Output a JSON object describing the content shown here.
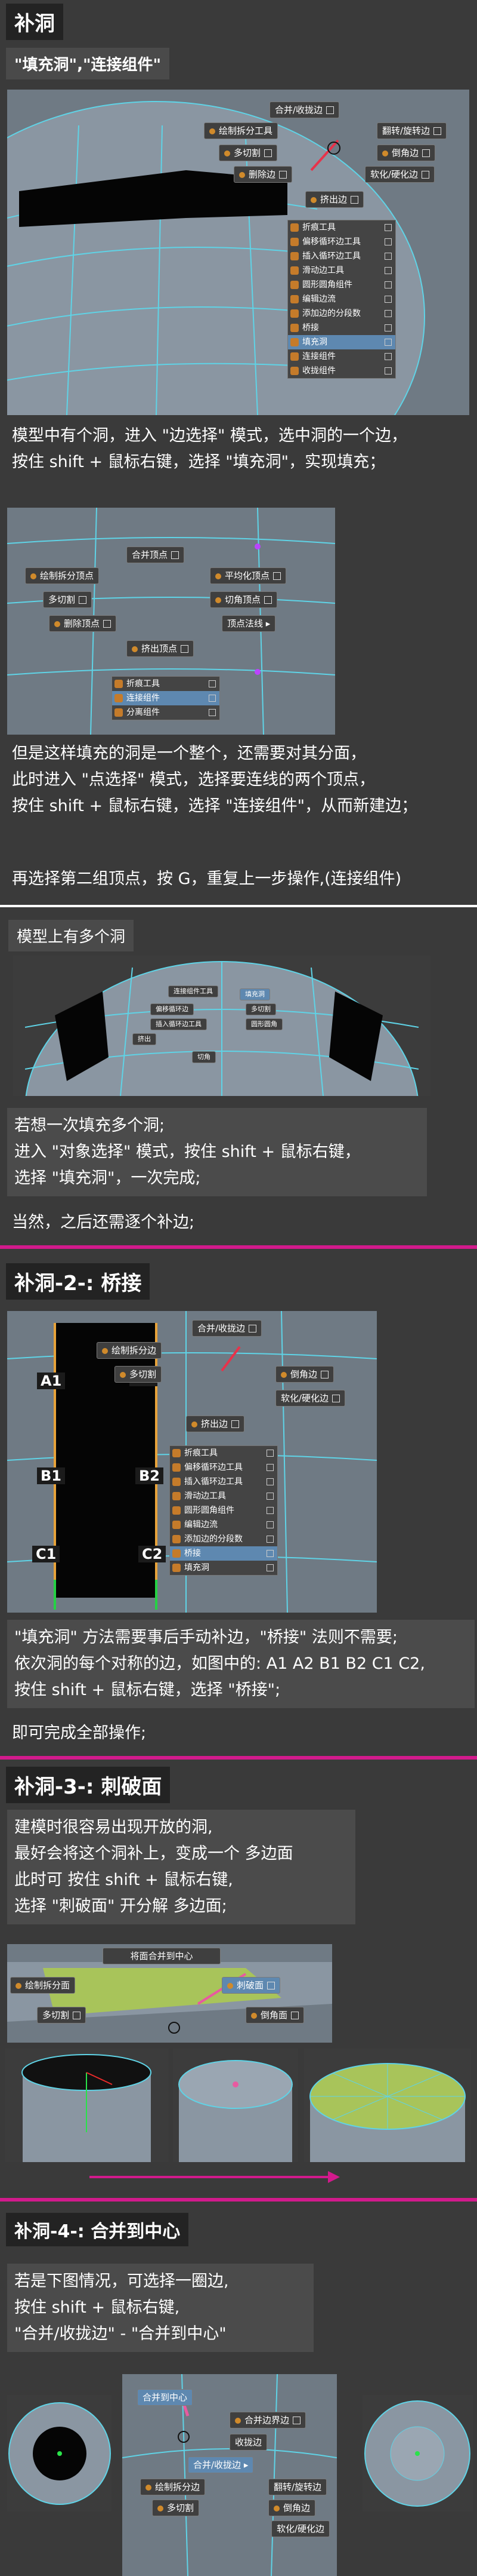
{
  "sec1": {
    "title": "补洞",
    "caption": "\"填充洞\",\"连接组件\"",
    "menu1": {
      "merge": "合并/收拢边",
      "flip": "翻转/旋转边",
      "draw_split": "绘制拆分工具",
      "bevel": "倒角边",
      "multicut": "多切割",
      "soften": "软化/硬化边",
      "delete_edge": "删除边",
      "extrude": "挤出边",
      "list": [
        "折痕工具",
        "偏移循环边工具",
        "插入循环边工具",
        "滑动边工具",
        "圆形圆角组件",
        "编辑边流",
        "添加边的分段数",
        "桥接",
        "填充洞",
        "连接组件",
        "收拢组件"
      ],
      "selected_index": 8
    },
    "text1": [
      "模型中有个洞，进入 \"边选择\" 模式，选中洞的一个边，",
      "按住 shift + 鼠标右键，选择 \"填充洞\"，实现填充；"
    ],
    "menu2": {
      "merge_vertex": "合并顶点",
      "draw_split": "绘制拆分顶点",
      "smooth": "平均化顶点",
      "multicut": "多切割",
      "chamfer": "切角顶点",
      "delete_vertex": "删除顶点",
      "vertex_normal": "顶点法线",
      "extrude_vertex": "挤出顶点",
      "list": [
        "折痕工具",
        "连接组件",
        "分离组件"
      ],
      "selected_index": 1
    },
    "text2": [
      "但是这样填充的洞是一个整个，还需要对其分面，",
      "此时进入 \"点选择\" 模式，选择要连线的两个顶点，",
      "按住 shift + 鼠标右键，选择 \"连接组件\"，从而新建边；"
    ],
    "text3": "再选择第二组顶点，按 G，重复上一步操作,(连接组件)"
  },
  "sec2": {
    "caption": "模型上有多个洞",
    "menu": {
      "items": [
        "连接组件工具",
        "偏移循环边",
        "插入循环边工具",
        "挤出",
        "填充洞",
        "多切割",
        "圆形圆角",
        "切角"
      ]
    },
    "text": [
      "若想一次填充多个洞;",
      "进入 \"对象选择\" 模式，按住 shift + 鼠标右键，",
      "选择 \"填充洞\"，一次完成;"
    ],
    "text2": "当然，之后还需逐个补边;"
  },
  "sec3": {
    "title": "补洞-2-: 桥接",
    "labels": [
      "A1",
      "A2",
      "B1",
      "B2",
      "C1",
      "C2"
    ],
    "menu": {
      "merge": "合并/收拢边",
      "draw_split": "绘制拆分边",
      "bevel": "倒角边",
      "multicut": "多切割",
      "soften": "软化/硬化边",
      "extrude": "挤出边",
      "list": [
        "折痕工具",
        "偏移循环边工具",
        "插入循环边工具",
        "滑动边工具",
        "圆形圆角组件",
        "编辑边流",
        "添加边的分段数",
        "桥接",
        "填充洞"
      ],
      "selected_index": 7
    },
    "text": [
      "\"填充洞\" 方法需要事后手动补边，\"桥接\" 法则不需要;",
      "依次洞的每个对称的边，如图中的: A1 A2 B1 B2 C1 C2,",
      "按住 shift + 鼠标右键，选择 \"桥接\";"
    ],
    "text2": "即可完成全部操作;"
  },
  "sec4": {
    "title": "补洞-3-: 刺破面",
    "text": [
      "建模时很容易出现开放的洞,",
      "最好会将这个洞补上，变成一个 多边面",
      "此时可 按住 shift + 鼠标右键,",
      "选择 \"刺破面\" 开分解 多边面;"
    ],
    "menu": {
      "merge_center": "将面合并到中心",
      "draw_split": "绘制拆分面",
      "poke": "刺破面",
      "multicut": "多切割",
      "chamfer": "倒角面"
    }
  },
  "sec5": {
    "title": "补洞-4-: 合并到中心",
    "text": [
      "若是下图情况，可选择一圈边,",
      "按住 shift + 鼠标右键,",
      "\"合并/收拢边\" - \"合并到中心\""
    ],
    "menu": {
      "merge_center": "合并到中心",
      "merge_edge": "合并边界边",
      "collapse": "收拢边",
      "merge": "合并/收拢边",
      "flip": "翻转/旋转边",
      "draw_split": "绘制拆分边",
      "bevel": "倒角边",
      "multicut": "多切割",
      "soften": "软化/硬化边"
    }
  },
  "colors": {
    "accent_magenta": "#d21a8c",
    "selected": "#5e88b0",
    "viewport": "#6f7a84"
  }
}
